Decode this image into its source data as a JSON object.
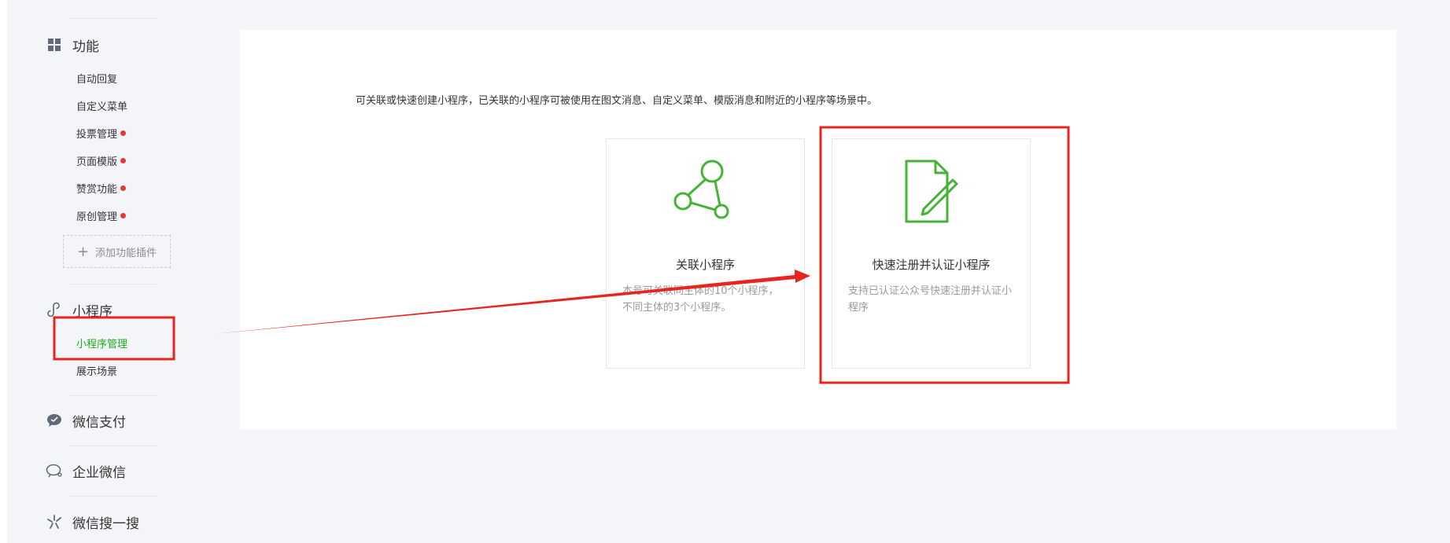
{
  "sidebar": {
    "function_section": {
      "label": "功能",
      "icon": "grid-icon"
    },
    "function_items": [
      {
        "label": "自动回复",
        "has_dot": false
      },
      {
        "label": "自定义菜单",
        "has_dot": false
      },
      {
        "label": "投票管理",
        "has_dot": true
      },
      {
        "label": "页面模版",
        "has_dot": true
      },
      {
        "label": "赞赏功能",
        "has_dot": true
      },
      {
        "label": "原创管理",
        "has_dot": true
      }
    ],
    "add_plugin_label": "添加功能插件",
    "miniprogram_section": {
      "label": "小程序",
      "icon": "link-icon"
    },
    "miniprogram_items": [
      {
        "label": "小程序管理",
        "active": true
      },
      {
        "label": "展示场景",
        "active": false
      }
    ],
    "wechat_pay": {
      "label": "微信支付",
      "icon": "chat-bubble-icon"
    },
    "work_wechat": {
      "label": "企业微信",
      "icon": "speech-icon"
    },
    "wechat_search": {
      "label": "微信搜一搜",
      "icon": "search-spark-icon"
    }
  },
  "main": {
    "description": "可关联或快速创建小程序，已关联的小程序可被使用在图文消息、自定义菜单、模版消息和附近的小程序等场景中。",
    "options": [
      {
        "title": "关联小程序",
        "description": "本号可关联同主体的10个小程序，不同主体的3个小程序。",
        "icon": "share-nodes-icon"
      },
      {
        "title": "快速注册并认证小程序",
        "description": "支持已认证公众号快速注册并认证小程序",
        "icon": "document-pen-icon"
      }
    ]
  },
  "colors": {
    "accent_green": "#1aad19",
    "icon_green": "#45b337",
    "annotation_red": "#e8241e",
    "dot_red": "#e4393c"
  }
}
